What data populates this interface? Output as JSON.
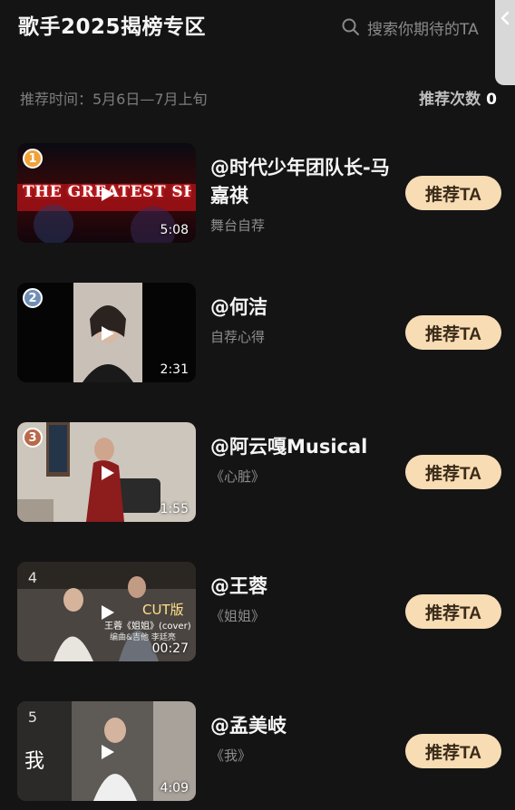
{
  "header": {
    "title": "歌手2025揭榜专区",
    "search_placeholder": "搜索你期待的TA"
  },
  "meta": {
    "time_label": "推荐时间：5月6日—7月上旬",
    "count_label": "推荐次数",
    "count_value": "0"
  },
  "items": [
    {
      "rank": "1",
      "duration": "5:08",
      "name": "@时代少年团队长-马嘉祺",
      "subtitle": "舞台自荐",
      "button": "推荐TA",
      "thumb_text": "THE GREATEST SHOW",
      "rank_color": "#f0a23a"
    },
    {
      "rank": "2",
      "duration": "2:31",
      "name": "@何洁",
      "subtitle": "自荐心得",
      "button": "推荐TA",
      "rank_color": "#6f8fb5"
    },
    {
      "rank": "3",
      "duration": "1:55",
      "name": "@阿云嘎Musical",
      "subtitle": "《心脏》",
      "button": "推荐TA",
      "rank_color": "#b86a4a"
    },
    {
      "rank": "4",
      "duration": "00:27",
      "name": "@王蓉",
      "subtitle": "《姐姐》",
      "button": "推荐TA",
      "thumb_badge": "CUT版",
      "thumb_caption": "王蓉《姐姐》(cover)",
      "thumb_caption2": "编曲&吉他 李廷亮"
    },
    {
      "rank": "5",
      "duration": "4:09",
      "name": "@孟美岐",
      "subtitle": "《我》",
      "button": "推荐TA",
      "thumb_glyph": "我"
    }
  ]
}
